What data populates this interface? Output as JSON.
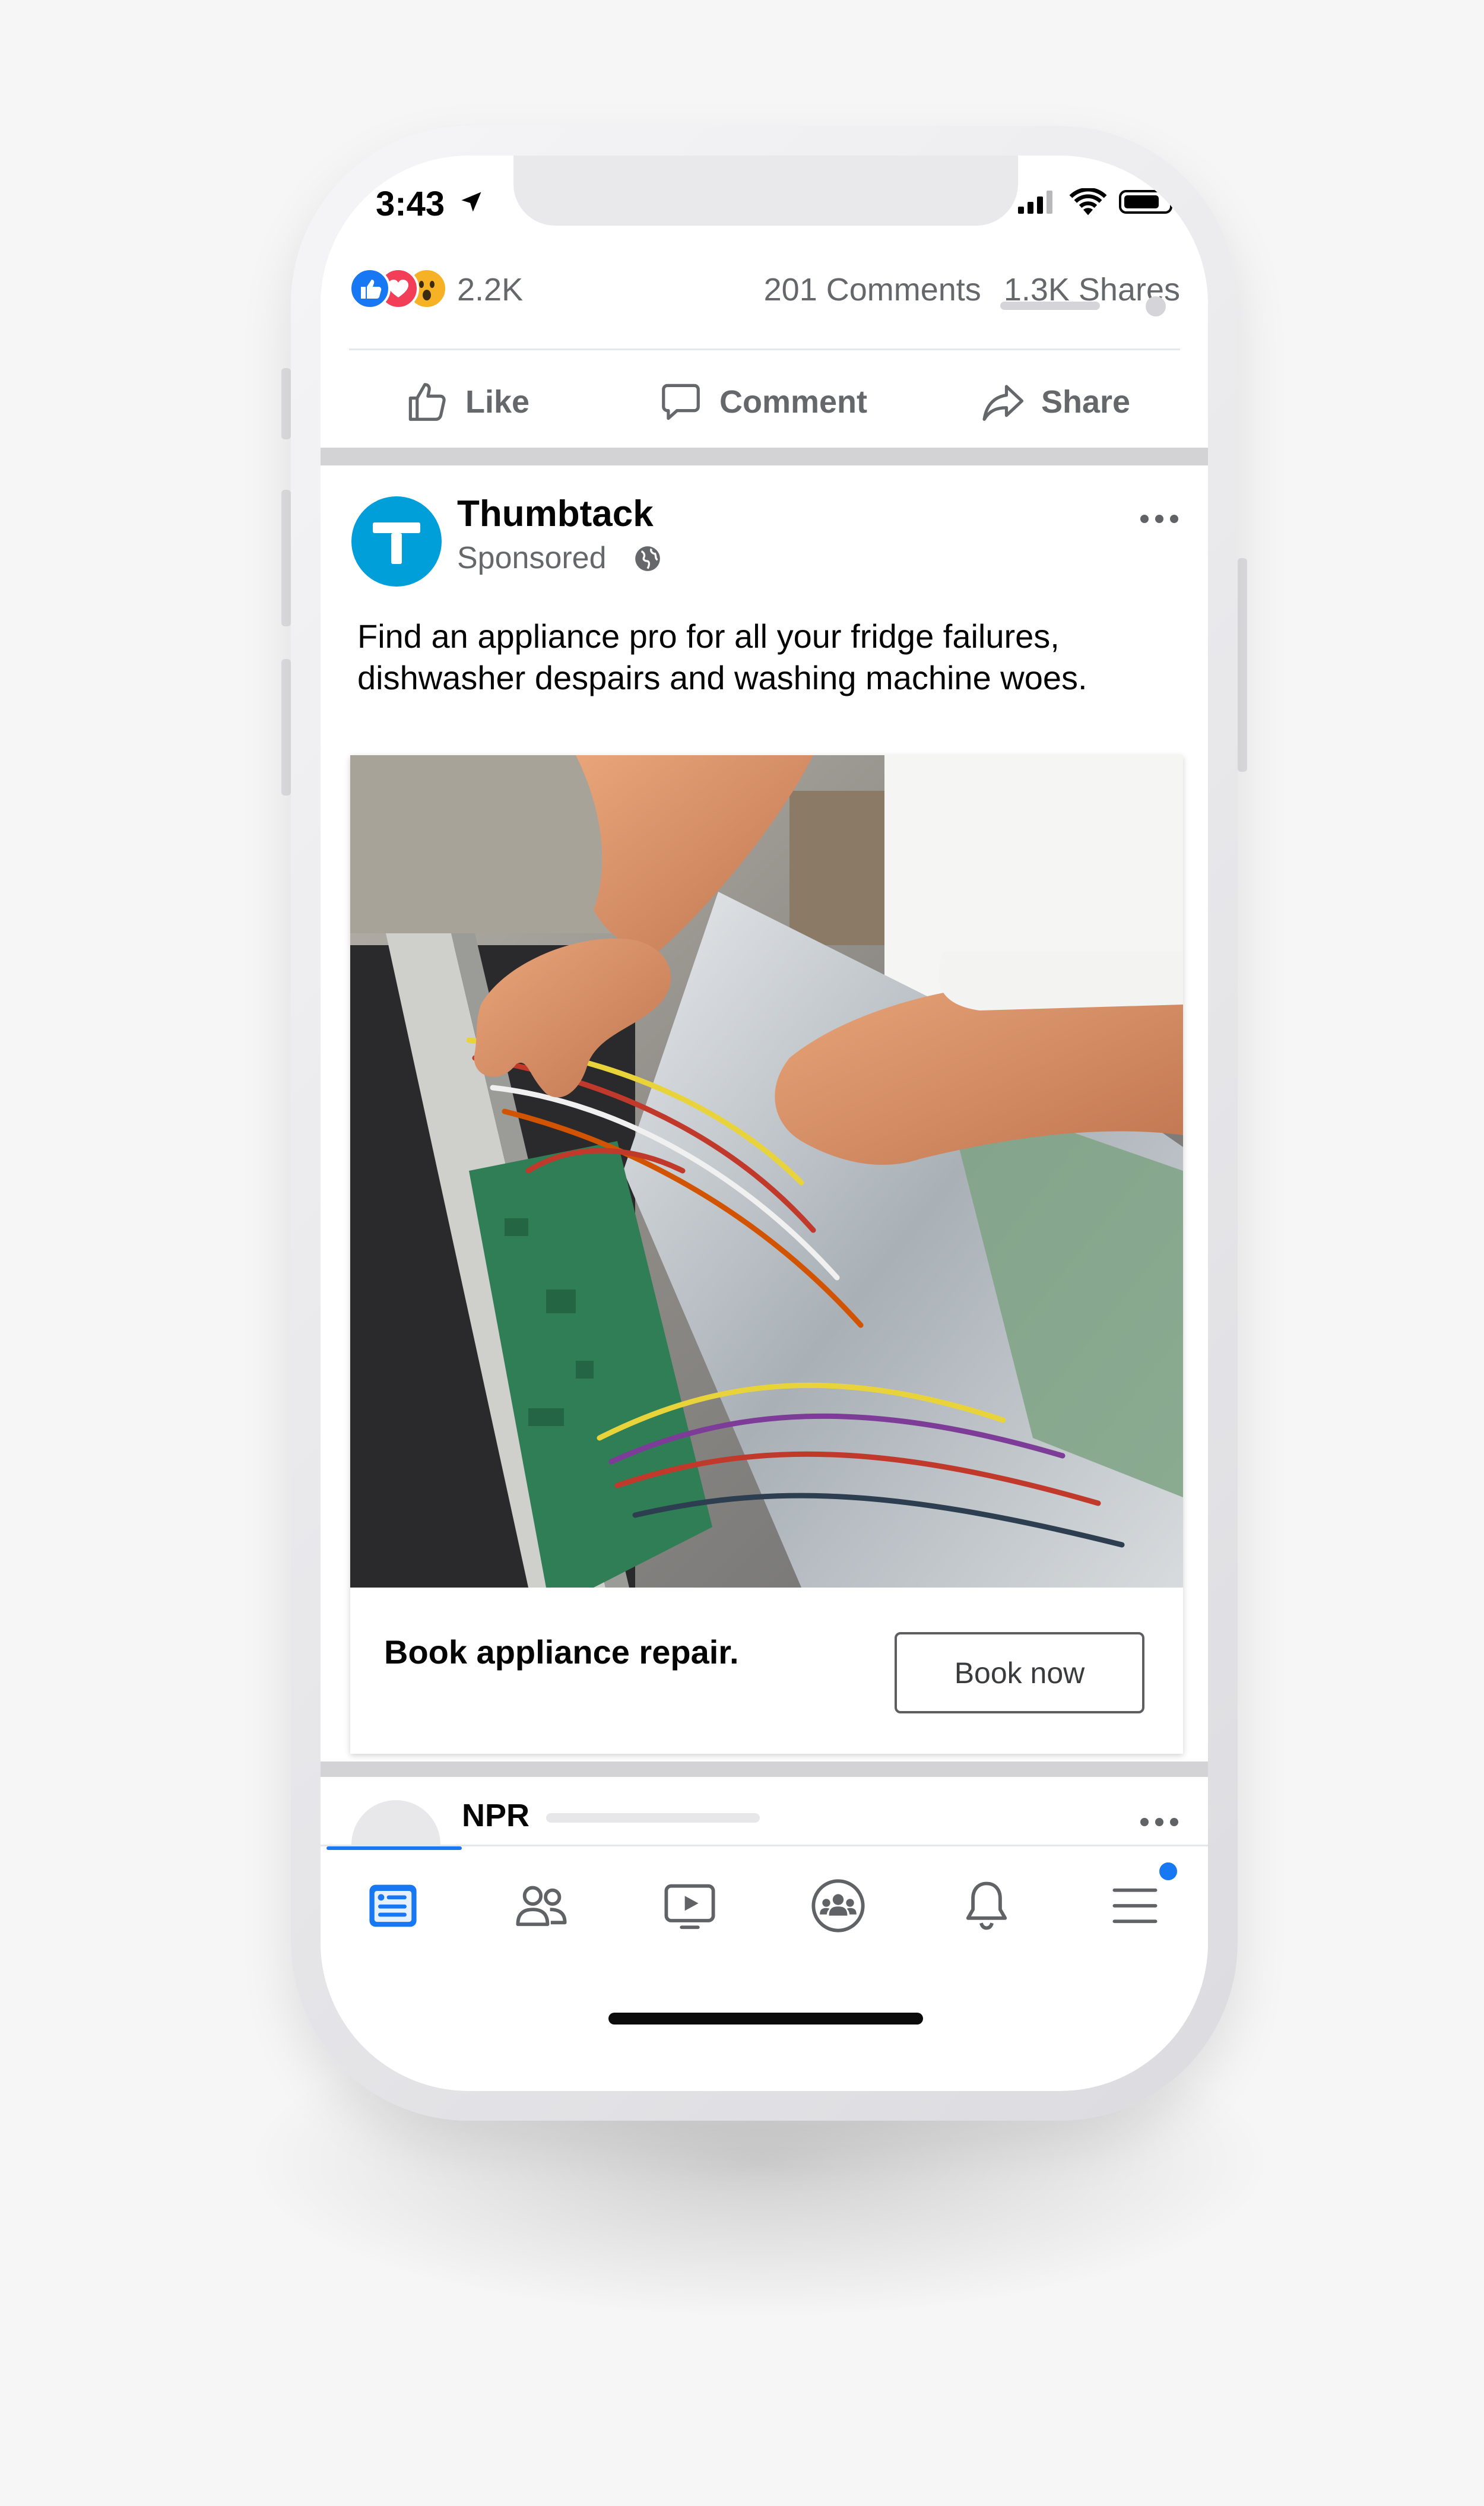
{
  "status_bar": {
    "time": "3:43"
  },
  "post_stats": {
    "reaction_count": "2.2K",
    "comments": "201 Comments",
    "shares": "1.3K Shares"
  },
  "actions": {
    "like": "Like",
    "comment": "Comment",
    "share": "Share"
  },
  "ad_post": {
    "page_name": "Thumbtack",
    "sponsored": "Sponsored",
    "text_line1": "Find an appliance pro for all your fridge failures,",
    "text_line2": "dishwasher despairs and washing machine woes.",
    "cta_headline": "Book appliance repair.",
    "cta_button": "Book now"
  },
  "next_post": {
    "page_name": "NPR"
  },
  "tabbar": {
    "items": [
      "news-feed-icon",
      "friends-icon",
      "watch-icon",
      "groups-icon",
      "notifications-icon",
      "menu-icon"
    ],
    "active": "news-feed-icon"
  },
  "colors": {
    "facebook_blue": "#1877f2",
    "thumbtack_blue": "#009fd9",
    "muted_text": "#65676b"
  }
}
